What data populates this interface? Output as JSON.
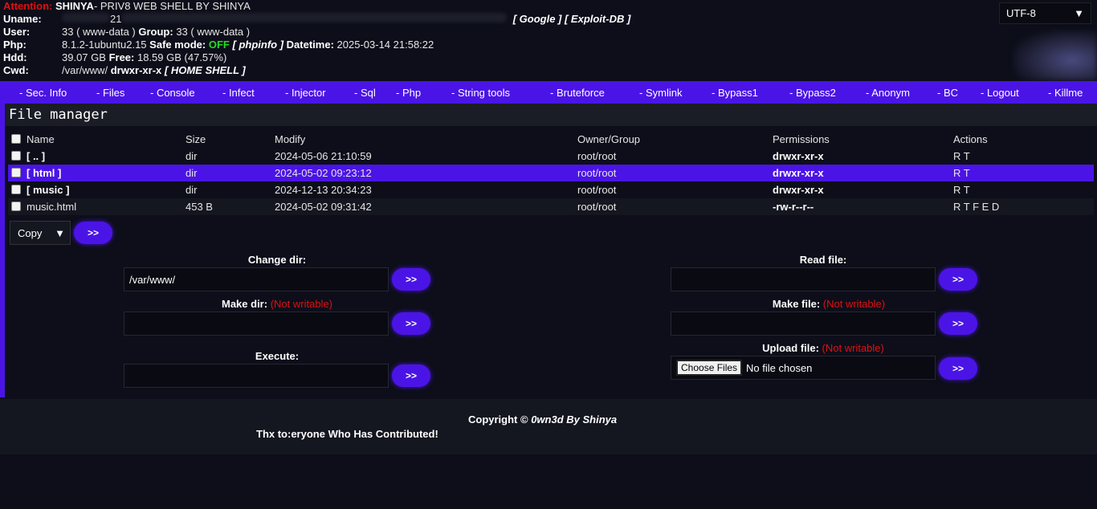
{
  "header": {
    "attention_label": "Attention:",
    "title_name": "SHINYA",
    "title_rest": " - PRIV8 WEB SHELL BY SHINYA",
    "uname_label": "Uname:",
    "uname_value": "21",
    "links": "[ Google ] [ Exploit-DB ]",
    "user_label": "User:",
    "user_value": "33 ( www-data )",
    "group_label": "Group:",
    "group_value": "33 ( www-data )",
    "php_label": "Php:",
    "php_version": "8.1.2-1ubuntu2.15",
    "safe_mode_label": "Safe mode:",
    "safe_mode_value": "OFF",
    "phpinfo_link": "[ phpinfo ]",
    "datetime_label": "Datetime:",
    "datetime_value": "2025-03-14 21:58:22",
    "hdd_label": "Hdd:",
    "hdd_total": "39.07 GB",
    "free_label": "Free:",
    "hdd_free": "18.59 GB (47.57%)",
    "cwd_label": "Cwd:",
    "cwd_path": "/var/www/",
    "cwd_perms": "drwxr-xr-x",
    "home_shell": "[ HOME SHELL ]",
    "charset": "UTF-8"
  },
  "nav": [
    "- Sec. Info",
    "- Files",
    "- Console",
    "- Infect",
    "- Injector",
    "- Sql",
    "- Php",
    "- String tools",
    "- Bruteforce",
    "- Symlink",
    "- Bypass1",
    "- Bypass2",
    "- Anonym",
    "- BC",
    "- Logout",
    "- Killme"
  ],
  "file_manager": {
    "title": "File manager",
    "columns": [
      "Name",
      "Size",
      "Modify",
      "Owner/Group",
      "Permissions",
      "Actions"
    ],
    "rows": [
      {
        "name": "[ .. ]",
        "size": "dir",
        "modify": "2024-05-06 21:10:59",
        "owner": "root/root",
        "perms": "drwxr-xr-x",
        "actions": "R T"
      },
      {
        "name": "[ html ]",
        "size": "dir",
        "modify": "2024-05-02 09:23:12",
        "owner": "root/root",
        "perms": "drwxr-xr-x",
        "actions": "R T"
      },
      {
        "name": "[ music ]",
        "size": "dir",
        "modify": "2024-12-13 20:34:23",
        "owner": "root/root",
        "perms": "drwxr-xr-x",
        "actions": "R T"
      },
      {
        "name": "music.html",
        "size": "453 B",
        "modify": "2024-05-02 09:31:42",
        "owner": "root/root",
        "perms": "-rw-r--r--",
        "actions": "R T F E D"
      }
    ],
    "bulk_action": "Copy",
    "go_label": ">>"
  },
  "forms": {
    "change_dir_label": "Change dir:",
    "change_dir_value": "/var/www/",
    "make_dir_label": "Make dir:",
    "not_writable": "(Not writable)",
    "execute_label": "Execute:",
    "read_file_label": "Read file:",
    "make_file_label": "Make file:",
    "upload_file_label": "Upload file:",
    "choose_files": "Choose Files",
    "no_file": "No file chosen"
  },
  "footer": {
    "copyright": "Copyright ©",
    "owned_by": "0wn3d By Shinya",
    "thx_label": "Thx to:",
    "thx_text": "eryone Who Has Contributed!"
  },
  "colors": {
    "accent": "#4b14e6",
    "warning": "#e01010",
    "ok": "#22dd22",
    "background": "#0d0e1a"
  }
}
